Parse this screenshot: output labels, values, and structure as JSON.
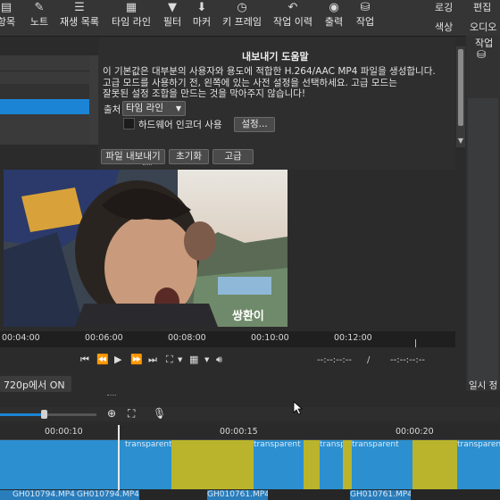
{
  "toolbar": {
    "items": [
      {
        "label": "항목",
        "icon": "list-icon"
      },
      {
        "label": "노트",
        "icon": "note-icon"
      },
      {
        "label": "재생 목록",
        "icon": "playlist-icon"
      },
      {
        "label": "타임 라인",
        "icon": "timeline-icon"
      },
      {
        "label": "필터",
        "icon": "filter-icon"
      },
      {
        "label": "마커",
        "icon": "marker-icon"
      },
      {
        "label": "키 프레임",
        "icon": "keyframe-icon"
      },
      {
        "label": "작업 이력",
        "icon": "history-icon"
      },
      {
        "label": "출력",
        "icon": "export-icon"
      },
      {
        "label": "작업",
        "icon": "jobs-icon"
      }
    ],
    "right_top": [
      "로깅",
      "편집"
    ],
    "right_bottom": [
      "색상",
      "오디오"
    ]
  },
  "export": {
    "heading": "내보내기 도움말",
    "paragraph": [
      "이 기본값은 대부분의 사용자와 용도에 적합한 H.264/AAC MP4 파일을 생성합니다.",
      "고급 모드를 사용하기 전, 왼쪽에 있는 사전 설정을 선택하세요. 고급 모드는",
      "잘못된 설정 조합을 만드는 것을 막아주지 않습니다!"
    ],
    "source_label": "출처",
    "source_value": "타임 라인",
    "hw_encoder_label": "하드웨어 인코더 사용",
    "settings_button": "설정...",
    "export_file_button": "파일 내보내기",
    "reset_button": "초기화",
    "advanced_button": "고급"
  },
  "right_strip": {
    "title": "작업",
    "bottom_label": "일시 정"
  },
  "video": {
    "caption": "쌍환이"
  },
  "player": {
    "ruler_ticks": [
      "00:04:00",
      "00:06:00",
      "00:08:00",
      "00:10:00",
      "00:12:00"
    ],
    "timecode_in": "--:--:--:--",
    "timecode_sep": "/",
    "timecode_out": "--:--:--:--"
  },
  "status": {
    "notice": "720p에서 ON"
  },
  "timeline": {
    "ruler_ticks": [
      "00:00:10",
      "00:00:15",
      "00:00:20"
    ],
    "transparent_label": "transparent",
    "clip_labels": [
      "GH010794.MP4",
      "GH010794.MP4",
      "GH010761.MP4",
      "GH010761.MP4"
    ]
  },
  "colors": {
    "accent": "#1b84d4",
    "clip_blue": "#2b8fd0",
    "clip_yellow": "#b9b42c"
  }
}
